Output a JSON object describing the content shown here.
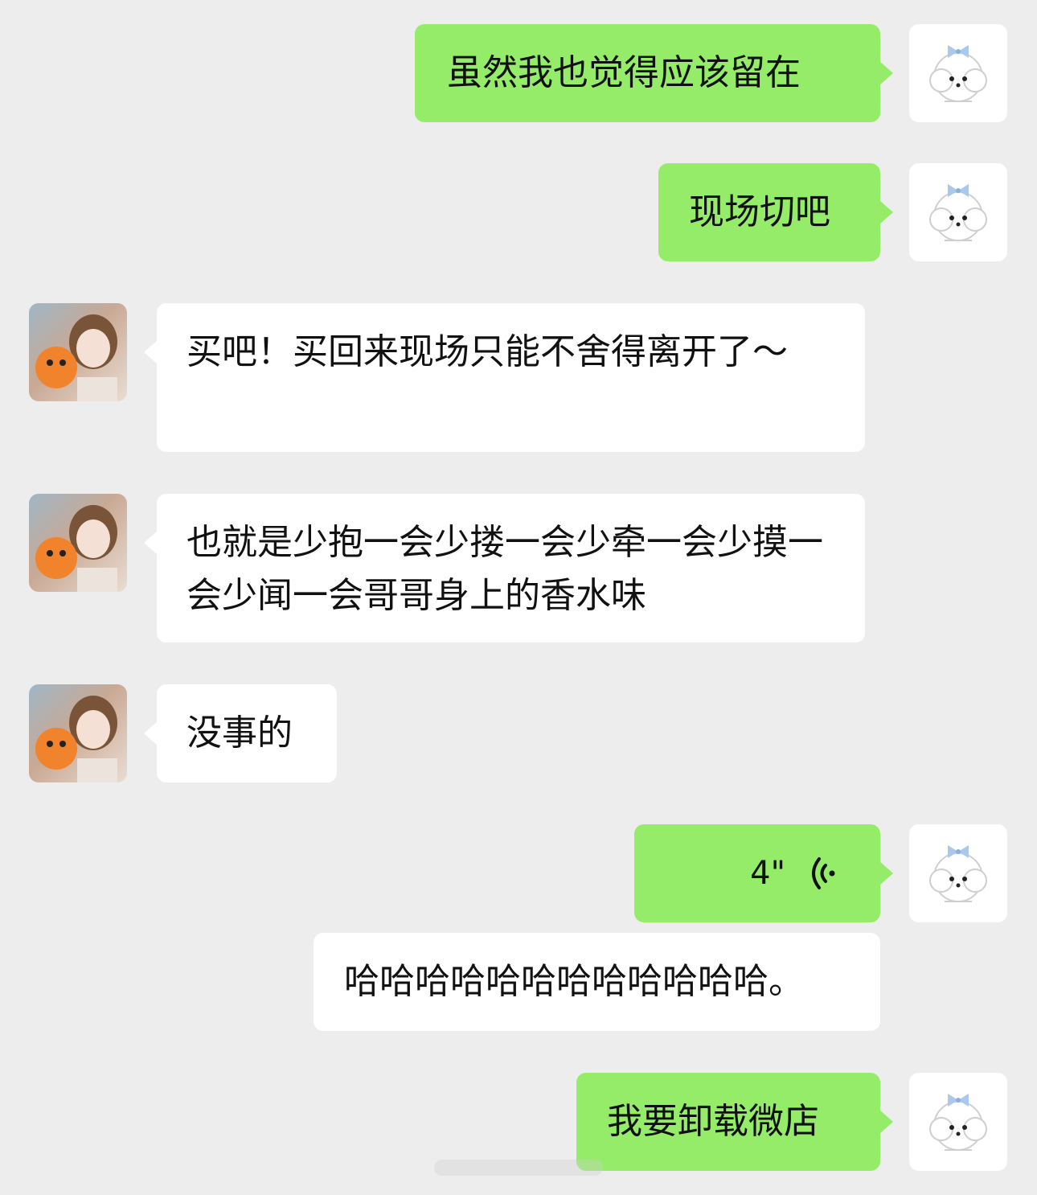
{
  "messages": [
    {
      "id": 1,
      "side": "outgoing",
      "text": "虽然我也觉得应该留在"
    },
    {
      "id": 2,
      "side": "outgoing",
      "text": "现场切吧"
    },
    {
      "id": 3,
      "side": "incoming",
      "text": "买吧！买回来现场只能不舍得离开了～"
    },
    {
      "id": 4,
      "side": "incoming",
      "text": "也就是少抱一会少搂一会少牵一会少摸一会少闻一会哥哥身上的香水味"
    },
    {
      "id": 5,
      "side": "incoming",
      "text": "没事的"
    },
    {
      "id": 6,
      "side": "outgoing",
      "type": "voice",
      "duration": "4\""
    },
    {
      "id": 7,
      "side": "outgoing",
      "type": "transcript",
      "text": "哈哈哈哈哈哈哈哈哈哈哈哈。"
    },
    {
      "id": 8,
      "side": "outgoing",
      "text": "我要卸载微店"
    }
  ],
  "colors": {
    "background": "#ededed",
    "outgoing_bubble": "#95ec69",
    "incoming_bubble": "#ffffff"
  },
  "icons": {
    "self_avatar": "white-puppy-with-blue-bow",
    "peer_avatar": "girl-with-orange-plush",
    "voice": "voice-wave-icon"
  }
}
